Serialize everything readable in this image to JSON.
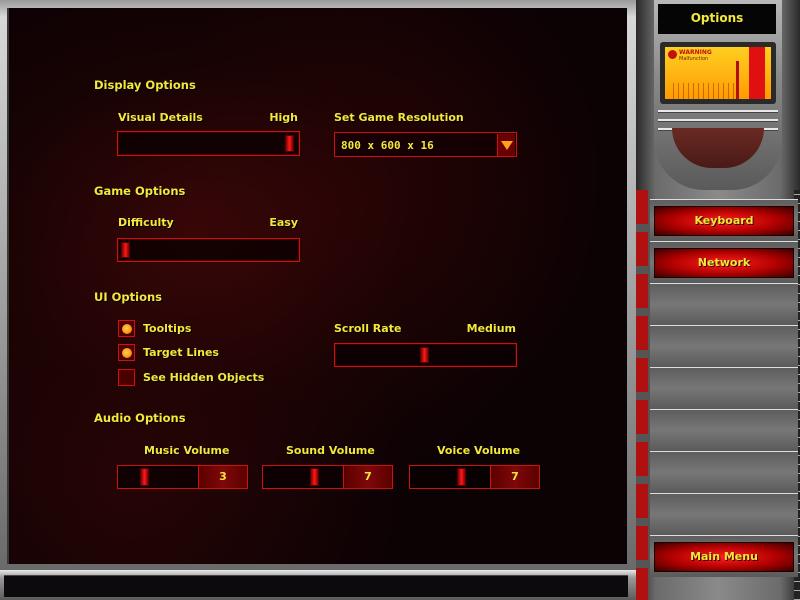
{
  "sidebar": {
    "title": "Options",
    "screen": {
      "warning_text": "WARNING",
      "subtext": "Malfunction"
    },
    "buttons": [
      {
        "label": "Keyboard"
      },
      {
        "label": "Network"
      },
      {
        "label": ""
      },
      {
        "label": ""
      },
      {
        "label": ""
      },
      {
        "label": ""
      },
      {
        "label": ""
      },
      {
        "label": "Main Menu"
      }
    ]
  },
  "display_options": {
    "heading": "Display Options",
    "visual_details": {
      "label": "Visual Details",
      "value_label": "High",
      "level": 1.0
    },
    "resolution": {
      "label": "Set Game Resolution",
      "selected": "800 x 600 x 16"
    }
  },
  "game_options": {
    "heading": "Game Options",
    "difficulty": {
      "label": "Difficulty",
      "value_label": "Easy",
      "level": 0.0
    }
  },
  "ui_options": {
    "heading": "UI Options",
    "checkboxes": [
      {
        "label": "Tooltips",
        "checked": true
      },
      {
        "label": "Target Lines",
        "checked": true
      },
      {
        "label": "See Hidden Objects",
        "checked": false
      }
    ],
    "scroll_rate": {
      "label": "Scroll Rate",
      "value_label": "Medium",
      "level": 0.5
    }
  },
  "audio_options": {
    "heading": "Audio Options",
    "music": {
      "label": "Music Volume",
      "value": "3",
      "level": 0.3
    },
    "sound": {
      "label": "Sound Volume",
      "value": "7",
      "level": 0.7
    },
    "voice": {
      "label": "Voice Volume",
      "value": "7",
      "level": 0.7
    }
  },
  "colors": {
    "text_yellow": "#f4e83a",
    "border_red": "#d01010",
    "thumb_red": "#ff1a1a",
    "checkbox_orange": "#ff9a10"
  }
}
